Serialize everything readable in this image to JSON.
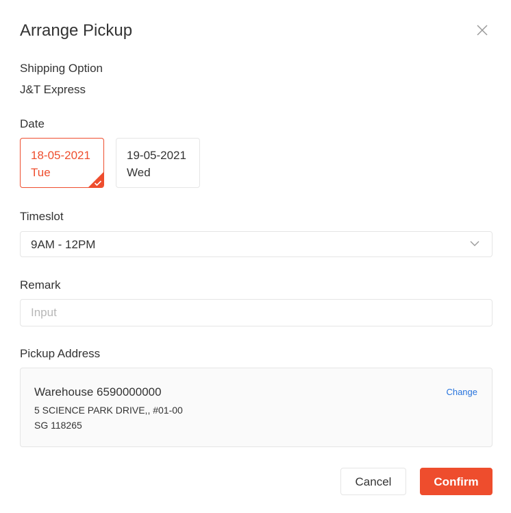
{
  "dialog": {
    "title": "Arrange Pickup"
  },
  "shipping": {
    "label": "Shipping Option",
    "value": "J&T Express"
  },
  "date": {
    "label": "Date",
    "options": [
      {
        "date": "18-05-2021",
        "day": "Tue",
        "selected": true
      },
      {
        "date": "19-05-2021",
        "day": "Wed",
        "selected": false
      }
    ]
  },
  "timeslot": {
    "label": "Timeslot",
    "selected": "9AM - 12PM"
  },
  "remark": {
    "label": "Remark",
    "placeholder": "Input",
    "value": ""
  },
  "pickup_address": {
    "label": "Pickup Address",
    "name": "Warehouse 6590000000",
    "line1": "5 SCIENCE PARK DRIVE,, #01-00",
    "line2": "SG 118265",
    "change_label": "Change"
  },
  "actions": {
    "cancel_label": "Cancel",
    "confirm_label": "Confirm"
  },
  "colors": {
    "accent": "#ee4d2d",
    "link": "#2673dd",
    "border": "#e5e5e5",
    "text": "#333333"
  },
  "icons": {
    "close": "close-icon",
    "check": "check-icon",
    "chevron": "chevron-down-icon"
  }
}
